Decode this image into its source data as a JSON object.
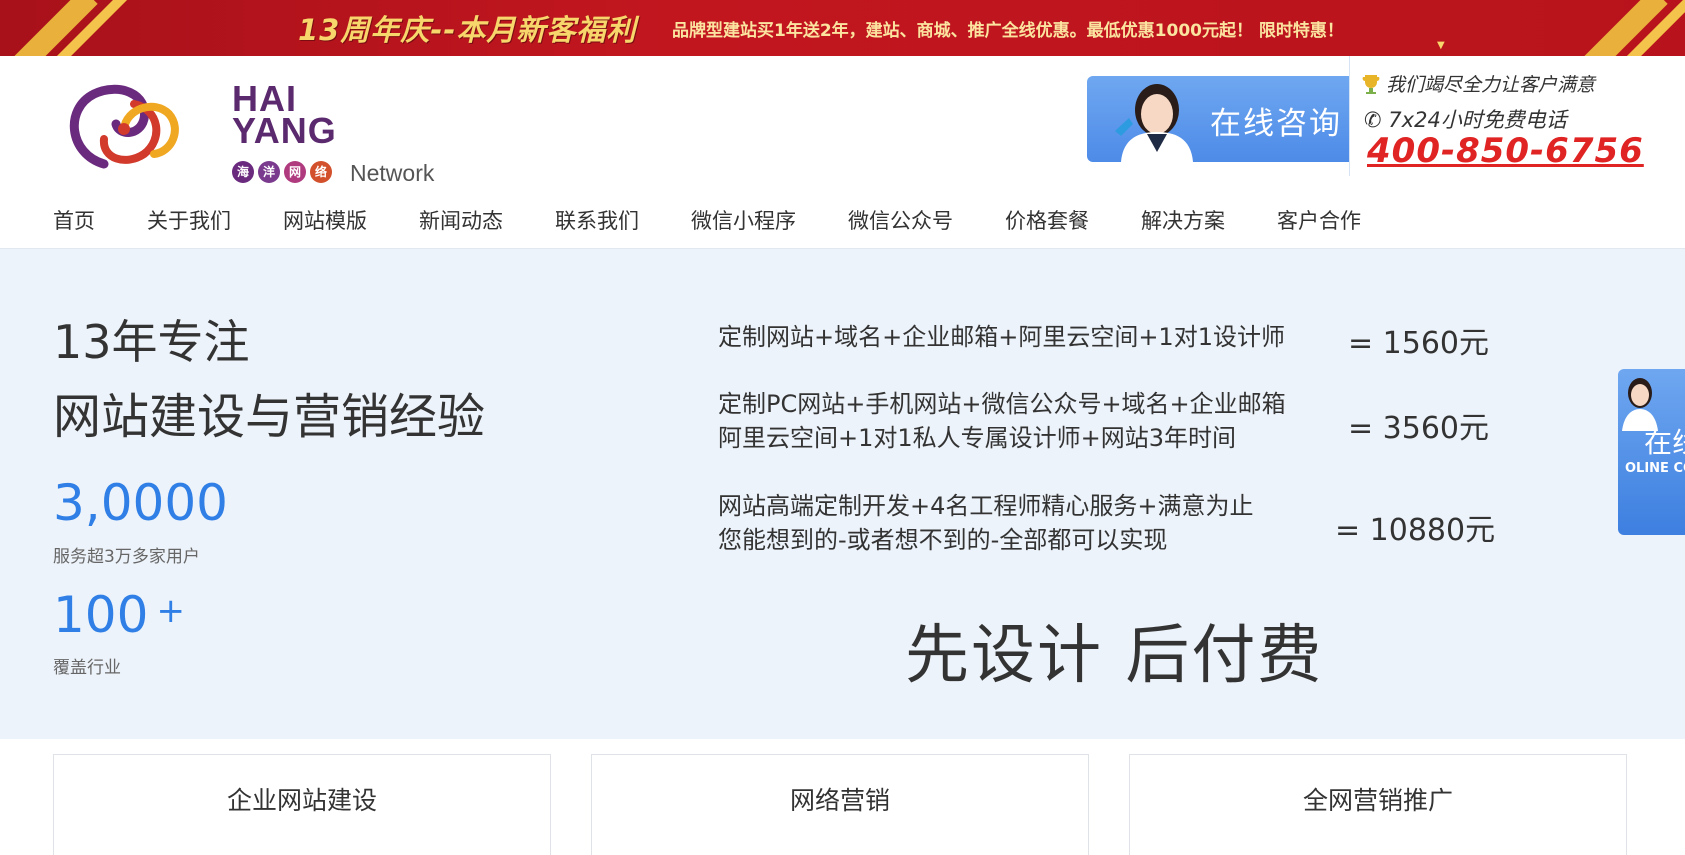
{
  "promo": {
    "headline": "13周年庆--本月新客福利",
    "sub": "品牌型建站买1年送2年，建站、商城、推广全线优惠。最低优惠1000元起！   限时特惠！"
  },
  "header": {
    "logo": {
      "line1": "HAI",
      "line2": "YANG",
      "badges": [
        "海",
        "洋",
        "网",
        "络"
      ],
      "network": "Network"
    },
    "consult_label": "在线咨询",
    "hotline": {
      "slogan": "我们竭尽全力让客户满意",
      "service": "7x24小时免费电话",
      "phone": "400-850-6756"
    }
  },
  "nav": {
    "items": [
      "首页",
      "关于我们",
      "网站模版",
      "新闻动态",
      "联系我们",
      "微信小程序",
      "微信公众号",
      "价格套餐",
      "解决方案",
      "客户合作"
    ]
  },
  "hero": {
    "title_line1": "13年专注",
    "title_line2": "网站建设与营销经验",
    "stat1_value": "3,0000",
    "stat1_caption": "服务超3万多家用户",
    "stat2_value": "100",
    "stat2_suffix": "+",
    "stat2_caption": "覆盖行业",
    "packages": [
      {
        "lines": [
          "定制网站+域名+企业邮箱+阿里云空间+1对1设计师"
        ],
        "price": "=  1560元"
      },
      {
        "lines": [
          "定制PC网站+手机网站+微信公众号+域名+企业邮箱",
          "阿里云空间+1对1私人专属设计师+网站3年时间"
        ],
        "price": "=  3560元"
      },
      {
        "lines": [
          "网站高端定制开发+4名工程师精心服务+满意为止",
          "您能想到的-或者想不到的-全部都可以实现"
        ],
        "price": "=  10880元"
      }
    ],
    "slogan": "先设计 后付费"
  },
  "side_float": {
    "label": "在线",
    "en": "OLINE CO"
  },
  "cards": [
    "企业网站建设",
    "网络营销",
    "全网营销推广"
  ],
  "colors": {
    "promo_red": "#b8131c",
    "promo_gold": "#f7d66b",
    "accent_blue": "#2f7fe6",
    "hero_bg": "#edf3fa",
    "phone_red": "#e02424"
  }
}
